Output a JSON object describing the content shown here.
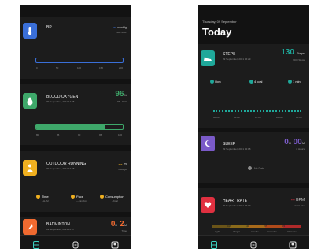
{
  "left": {
    "bp": {
      "title": "BP",
      "value": "---",
      "unit": "mmHg",
      "sub": "SBP/DBP",
      "ticks": [
        "0",
        "50",
        "100",
        "150",
        "200"
      ]
    },
    "oxygen": {
      "title": "BLOOD OXYGEN",
      "date": "09 September, 2021 14:05",
      "value": "96",
      "unit": "%",
      "sub": "96 - 98%",
      "ticks": [
        "80",
        "85",
        "90",
        "95",
        "100"
      ],
      "fill": 0.8
    },
    "running": {
      "title": "OUTDOOR RUNNING",
      "date": "09 September, 2021 13:08",
      "value": "---",
      "unit": "m",
      "sub": "Mileage",
      "stats": [
        {
          "label": "Time",
          "value": "--H--M"
        },
        {
          "label": "Pace",
          "value": "---min/Km"
        },
        {
          "label": "Consumption",
          "value": "--Kcal"
        }
      ]
    },
    "badminton": {
      "title": "BADMINTON",
      "date": "09 September, 2021 15:07",
      "h": "0",
      "hu": "H",
      "m": "2",
      "mu": "M",
      "sub": "Time"
    }
  },
  "right": {
    "date": "Thursday, 09 September",
    "today": "Today",
    "steps": {
      "title": "STEPS",
      "date": "09 September, 2021 15:29",
      "value": "130",
      "unit": "Steps",
      "sub": "7000 Steps",
      "stats": [
        {
          "icon": "distance-icon",
          "value": "0km"
        },
        {
          "icon": "calories-icon",
          "value": "4 kcal"
        },
        {
          "icon": "time-icon",
          "value": "1 min"
        }
      ],
      "ticks": [
        "00:00",
        "06:00",
        "12:00",
        "18:00",
        "00:00"
      ]
    },
    "sleep": {
      "title": "SLEEP",
      "date": "09 September, 2021 12:18",
      "h": "0",
      "hu": "H",
      "m": "00",
      "mu": "M",
      "sub": "8 Hours",
      "nodata": "No Data"
    },
    "heart": {
      "title": "HEART RATE",
      "date": "09 September, 2021 15:09",
      "value": "---",
      "unit": "BPM",
      "sub": "Heart rate",
      "zones": [
        "118",
        "140",
        "157",
        "174"
      ],
      "zone_labels": [
        "Light",
        "Weight",
        "Aerobic",
        "Anaerobic",
        "VO2 max"
      ]
    }
  },
  "colors": {
    "bp": "#3a6fd8",
    "oxygen": "#3ea86a",
    "running": "#f0b020",
    "badminton": "#f06a30",
    "steps": "#1fa89a",
    "sleep": "#7a5ac8",
    "heart": "#e03040",
    "accent": "#3ad0c0"
  }
}
